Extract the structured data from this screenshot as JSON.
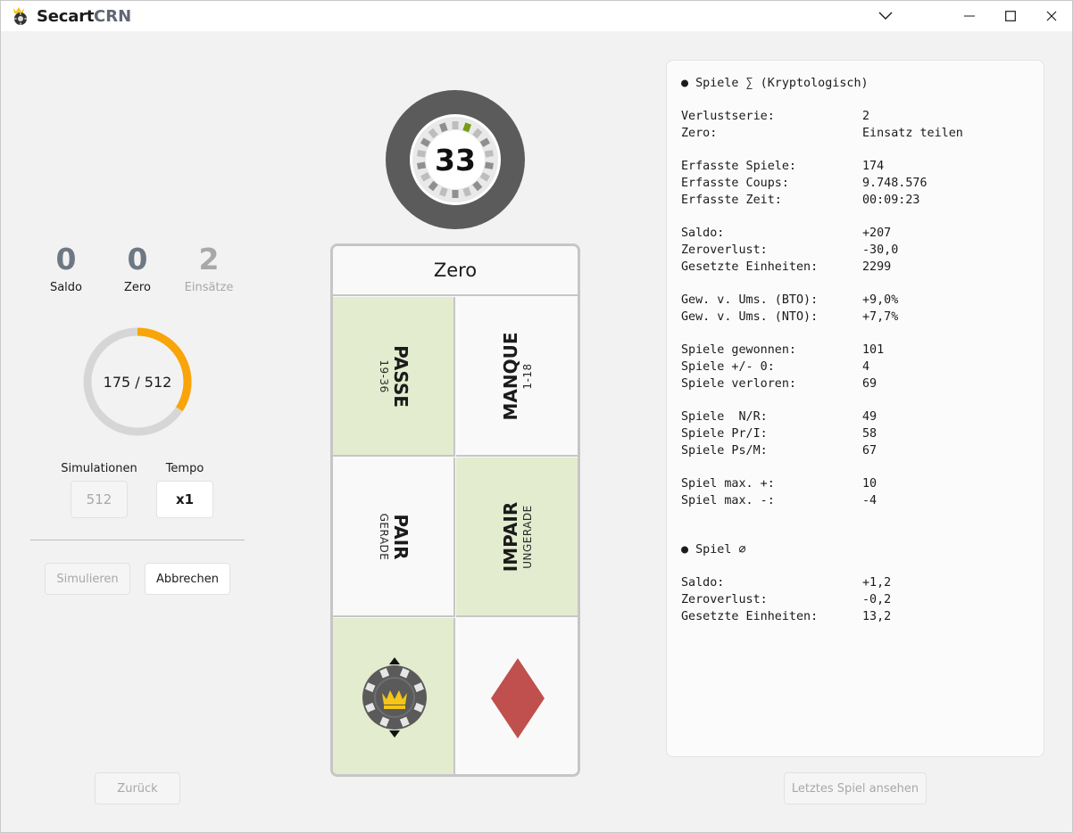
{
  "titlebar": {
    "app_name": "Secart",
    "app_sub": "CRN"
  },
  "left": {
    "stats": [
      {
        "value": "0",
        "label": "Saldo"
      },
      {
        "value": "0",
        "label": "Zero"
      },
      {
        "value": "2",
        "label": "Einsätze"
      }
    ],
    "progress": {
      "text": "175 / 512",
      "current": 175,
      "total": 512,
      "color": "#f9a408",
      "track_color": "#d6d6d6"
    },
    "simulations_label": "Simulationen",
    "simulations_value": "512",
    "tempo_label": "Tempo",
    "tempo_value": "x1",
    "simulate_button": "Simulieren",
    "cancel_button": "Abbrechen",
    "back_button": "Zurück"
  },
  "wheel": {
    "number": "33",
    "ring_color": "#5b5b5b",
    "marker_color": "#7a9a10"
  },
  "board": {
    "zero": "Zero",
    "passe": {
      "title": "PASSE",
      "sub": "19-36"
    },
    "manque": {
      "title": "MANQUE",
      "sub": "1-18"
    },
    "pair": {
      "title": "PAIR",
      "sub": "GERADE"
    },
    "impair": {
      "title": "IMPAIR",
      "sub": "UNGERADE"
    },
    "green": "#e3ecce",
    "red": "#c0504d"
  },
  "stats_panel": {
    "section1_title": "● Spiele ∑ (Kryptologisch)",
    "rows1": [
      {
        "k": "Verlustserie:",
        "v": "2"
      },
      {
        "k": "Zero:",
        "v": "Einsatz teilen"
      }
    ],
    "rows2": [
      {
        "k": "Erfasste Spiele:",
        "v": "174"
      },
      {
        "k": "Erfasste Coups:",
        "v": "9.748.576"
      },
      {
        "k": "Erfasste Zeit:",
        "v": "00:09:23"
      }
    ],
    "rows3": [
      {
        "k": "Saldo:",
        "v": "+207"
      },
      {
        "k": "Zeroverlust:",
        "v": "-30,0"
      },
      {
        "k": "Gesetzte Einheiten:",
        "v": "2299"
      }
    ],
    "rows4": [
      {
        "k": "Gew. v. Ums. (BTO):",
        "v": "+9,0%"
      },
      {
        "k": "Gew. v. Ums. (NTO):",
        "v": "+7,7%"
      }
    ],
    "rows5": [
      {
        "k": "Spiele gewonnen:",
        "v": "101"
      },
      {
        "k": "Spiele +/- 0:",
        "v": "4"
      },
      {
        "k": "Spiele verloren:",
        "v": "69"
      }
    ],
    "rows6": [
      {
        "k": "Spiele  N/R:",
        "v": "49"
      },
      {
        "k": "Spiele Pr/I:",
        "v": "58"
      },
      {
        "k": "Spiele Ps/M:",
        "v": "67"
      }
    ],
    "rows7": [
      {
        "k": "Spiel max. +:",
        "v": "10"
      },
      {
        "k": "Spiel max. -:",
        "v": "-4"
      }
    ],
    "section2_title": "● Spiel ∅",
    "rows8": [
      {
        "k": "Saldo:",
        "v": "+1,2"
      },
      {
        "k": "Zeroverlust:",
        "v": "-0,2"
      },
      {
        "k": "Gesetzte Einheiten:",
        "v": "13,2"
      }
    ]
  },
  "last_game_button": "Letztes Spiel ansehen"
}
